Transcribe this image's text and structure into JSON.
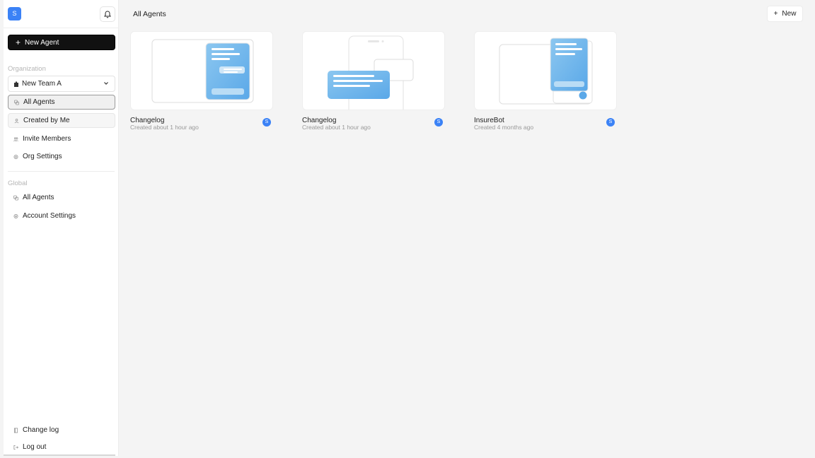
{
  "app": {
    "logo_letter": "S",
    "accent": "#3b82f6"
  },
  "sidebar": {
    "new_agent_label": "New Agent",
    "org_section_label": "Organization",
    "team_selected": "New Team A",
    "org_items": [
      {
        "label": "All Agents",
        "icon": "agents-icon",
        "state": "active"
      },
      {
        "label": "Created by Me",
        "icon": "user-icon",
        "state": "hover"
      },
      {
        "label": "Invite Members",
        "icon": "users-icon",
        "state": "normal"
      },
      {
        "label": "Org Settings",
        "icon": "gear-icon",
        "state": "normal"
      }
    ],
    "global_section_label": "Global",
    "global_items": [
      {
        "label": "All Agents",
        "icon": "agents-icon"
      },
      {
        "label": "Account Settings",
        "icon": "gear-icon"
      }
    ],
    "bottom_items": [
      {
        "label": "Change log",
        "icon": "book-icon"
      },
      {
        "label": "Log out",
        "icon": "logout-icon"
      }
    ]
  },
  "main": {
    "title": "All Agents",
    "new_button_label": "New",
    "cards": [
      {
        "title": "Changelog",
        "subtitle": "Created about 1 hour ago",
        "avatar": "S"
      },
      {
        "title": "Changelog",
        "subtitle": "Created about 1 hour ago",
        "avatar": "S"
      },
      {
        "title": "InsureBot",
        "subtitle": "Created 4 months ago",
        "avatar": "S"
      }
    ]
  }
}
